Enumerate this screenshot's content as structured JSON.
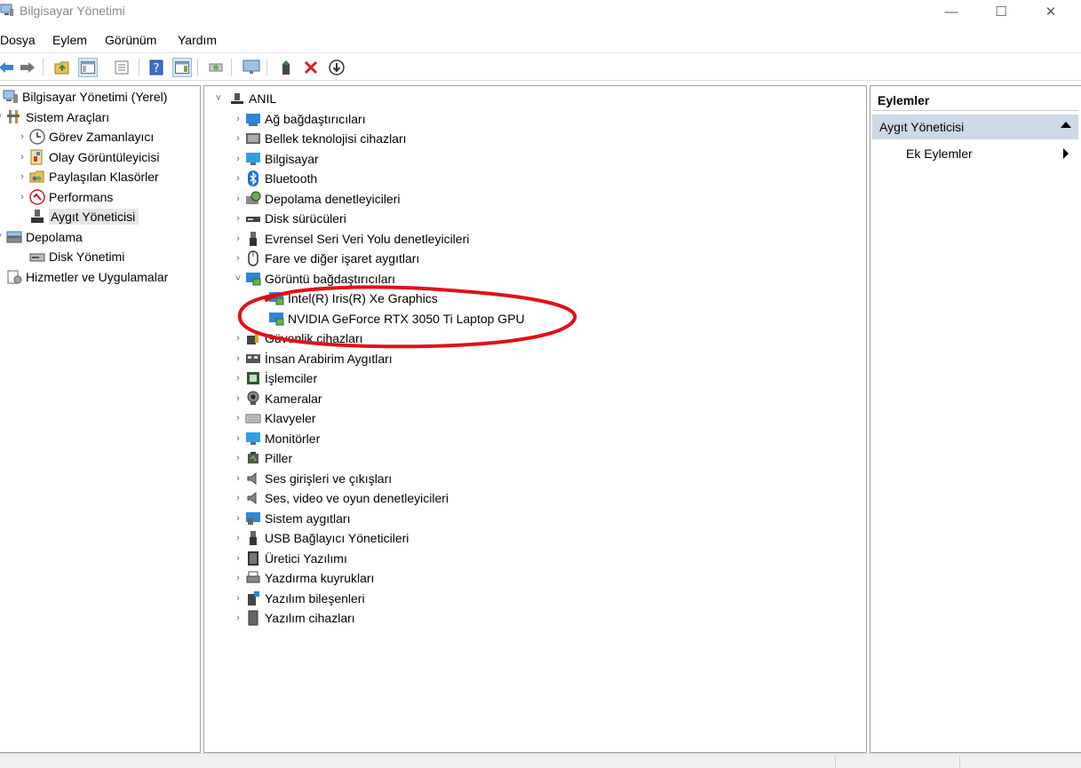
{
  "window": {
    "title": "Bilgisayar Yönetimi",
    "controls": {
      "minimize": "—",
      "maximize": "☐",
      "close": "✕"
    }
  },
  "menu": [
    "Dosya",
    "Eylem",
    "Görünüm",
    "Yardım"
  ],
  "toolbar": [
    {
      "icon": "back-arrow-icon"
    },
    {
      "icon": "forward-arrow-icon"
    },
    {
      "icon": "up-folder-icon"
    },
    {
      "icon": "show-hide-tree-icon"
    },
    {
      "icon": "properties-icon"
    },
    {
      "icon": "help-icon"
    },
    {
      "icon": "show-action-pane-icon"
    },
    {
      "icon": "scan-hardware-icon"
    },
    {
      "icon": "monitor-icon"
    },
    {
      "icon": "update-driver-icon"
    },
    {
      "icon": "uninstall-icon"
    },
    {
      "icon": "disable-device-icon"
    }
  ],
  "left_tree": [
    {
      "label": "Bilgisayar Yönetimi (Yerel)",
      "icon": "computer-management-icon",
      "indent": 0,
      "chevron": ""
    },
    {
      "label": "Sistem Araçları",
      "icon": "tools-icon",
      "indent": 1,
      "chevron": "˅"
    },
    {
      "label": "Görev Zamanlayıcı",
      "icon": "clock-icon",
      "indent": 2,
      "chevron": "›"
    },
    {
      "label": "Olay Görüntüleyicisi",
      "icon": "event-viewer-icon",
      "indent": 2,
      "chevron": "›"
    },
    {
      "label": "Paylaşılan Klasörler",
      "icon": "shared-folder-icon",
      "indent": 2,
      "chevron": "›"
    },
    {
      "label": "Performans",
      "icon": "performance-icon",
      "indent": 2,
      "chevron": "›"
    },
    {
      "label": "Aygıt Yöneticisi",
      "icon": "device-manager-icon",
      "indent": 2,
      "chevron": "",
      "selected": true
    },
    {
      "label": "Depolama",
      "icon": "storage-icon",
      "indent": 1,
      "chevron": "˅"
    },
    {
      "label": "Disk Yönetimi",
      "icon": "disk-icon",
      "indent": 2,
      "chevron": ""
    },
    {
      "label": "Hizmetler ve Uygulamalar",
      "icon": "services-icon",
      "indent": 1,
      "chevron": "›"
    }
  ],
  "device_tree": {
    "root": "ANIL",
    "categories": [
      {
        "label": "Ağ bağdaştırıcıları",
        "icon": "network-adapter-icon",
        "expanded": false
      },
      {
        "label": "Bellek teknolojisi cihazları",
        "icon": "memory-device-icon",
        "expanded": false
      },
      {
        "label": "Bilgisayar",
        "icon": "computer-icon",
        "expanded": false
      },
      {
        "label": "Bluetooth",
        "icon": "bluetooth-icon",
        "expanded": false
      },
      {
        "label": "Depolama denetleyicileri",
        "icon": "storage-controller-icon",
        "expanded": false
      },
      {
        "label": "Disk sürücüleri",
        "icon": "disk-drive-icon",
        "expanded": false
      },
      {
        "label": "Evrensel Seri Veri Yolu denetleyicileri",
        "icon": "usb-controller-icon",
        "expanded": false
      },
      {
        "label": "Fare ve diğer işaret aygıtları",
        "icon": "mouse-icon",
        "expanded": false
      },
      {
        "label": "Görüntü bağdaştırıcıları",
        "icon": "display-adapter-icon",
        "expanded": true,
        "children": [
          "Intel(R) Iris(R) Xe Graphics",
          "NVIDIA GeForce RTX 3050 Ti Laptop GPU"
        ]
      },
      {
        "label": "Güvenlik cihazları",
        "icon": "security-device-icon",
        "expanded": false
      },
      {
        "label": "İnsan Arabirim Aygıtları",
        "icon": "hid-icon",
        "expanded": false
      },
      {
        "label": "İşlemciler",
        "icon": "processor-icon",
        "expanded": false
      },
      {
        "label": "Kameralar",
        "icon": "camera-icon",
        "expanded": false
      },
      {
        "label": "Klavyeler",
        "icon": "keyboard-icon",
        "expanded": false
      },
      {
        "label": "Monitörler",
        "icon": "monitor-icon",
        "expanded": false
      },
      {
        "label": "Piller",
        "icon": "battery-icon",
        "expanded": false
      },
      {
        "label": "Ses girişleri ve çıkışları",
        "icon": "audio-io-icon",
        "expanded": false
      },
      {
        "label": "Ses, video ve oyun denetleyicileri",
        "icon": "sound-controller-icon",
        "expanded": false
      },
      {
        "label": "Sistem aygıtları",
        "icon": "system-device-icon",
        "expanded": false
      },
      {
        "label": "USB Bağlayıcı Yöneticileri",
        "icon": "usb-connector-icon",
        "expanded": false
      },
      {
        "label": "Üretici Yazılımı",
        "icon": "firmware-icon",
        "expanded": false
      },
      {
        "label": "Yazdırma kuyrukları",
        "icon": "print-queue-icon",
        "expanded": false
      },
      {
        "label": "Yazılım bileşenleri",
        "icon": "software-component-icon",
        "expanded": false
      },
      {
        "label": "Yazılım cihazları",
        "icon": "software-device-icon",
        "expanded": false
      }
    ]
  },
  "actions": {
    "header": "Eylemler",
    "section": "Aygıt Yöneticisi",
    "more": "Ek Eylemler"
  },
  "colors": {
    "annotation": "#e0101a",
    "section_bg": "#cfd8e6",
    "selected_bg": "#e5e5e5"
  }
}
